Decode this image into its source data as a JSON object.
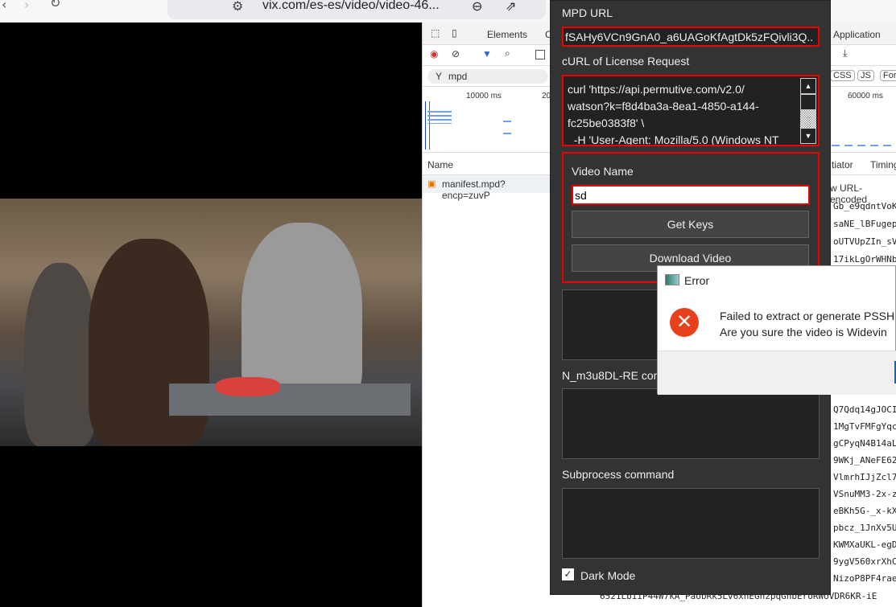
{
  "browser": {
    "url": "vix.com/es-es/video/video-46..."
  },
  "devtools": {
    "tabs": [
      "Elements",
      "C",
      "Application"
    ],
    "filter": "mpd",
    "filter_chips": [
      "CSS",
      "JS",
      "For"
    ],
    "timeline_labels": [
      "10000 ms",
      "200",
      "60000 ms"
    ],
    "columns": [
      "Name",
      "tiator",
      "Timing"
    ],
    "request": "manifest.mpd?encp=zuvP",
    "payload_header": "w URL-encoded",
    "payload_lines": [
      "Gb_e9qdntVoK",
      "saNE_lBFugep",
      "oUTVUpZIn_sV",
      "17ikLgOrWHNb",
      "Q7Qdq14gJOCI",
      "1MgTvFMFgYqc",
      "gCPyqN4B14aL",
      "9WKj_ANeFE62",
      "VlmrhIJjZcl7",
      "VSnuMM3-2x-z",
      "eBKh5G-_x-kX",
      "pbcz_1JnXv5U",
      "KWMXaUKL-egD",
      "9ygV560xrXhC",
      "NizoP8PF4rae"
    ],
    "bottom_line": "6521LbiiP44W7kA_PaUbRk5Lv6xhEGhzpqGhbEroRWUVDR6KR-iE"
  },
  "app": {
    "mpd_label": "MPD URL",
    "mpd_value": "fSAHy6VCn9GnA0_a6UAGoKfAgtDk5zFQivli3Q..",
    "curl_label": "cURL of License Request",
    "curl_value": "curl 'https://api.permutive.com/v2.0/\nwatson?k=f8d4ba3a-8ea1-4850-a144-\nfc25be0383f8' \\\n  -H 'User-Agent: Mozilla/5.0 (Windows NT",
    "video_name_label": "Video Name",
    "video_name_value": "sd",
    "get_keys": "Get Keys",
    "download": "Download Video",
    "n_m3u8_label": "N_m3u8DL-RE cor",
    "subprocess_label": "Subprocess command",
    "dark_mode": "Dark Mode",
    "dark_mode_checked": true
  },
  "dialog": {
    "title": "Error",
    "line1": "Failed to extract or generate PSSH",
    "line2": "Are you sure the video is Widevin"
  },
  "colors": {
    "accent_red": "#e00000",
    "app_bg": "#333333",
    "error_icon": "#e8401c"
  }
}
